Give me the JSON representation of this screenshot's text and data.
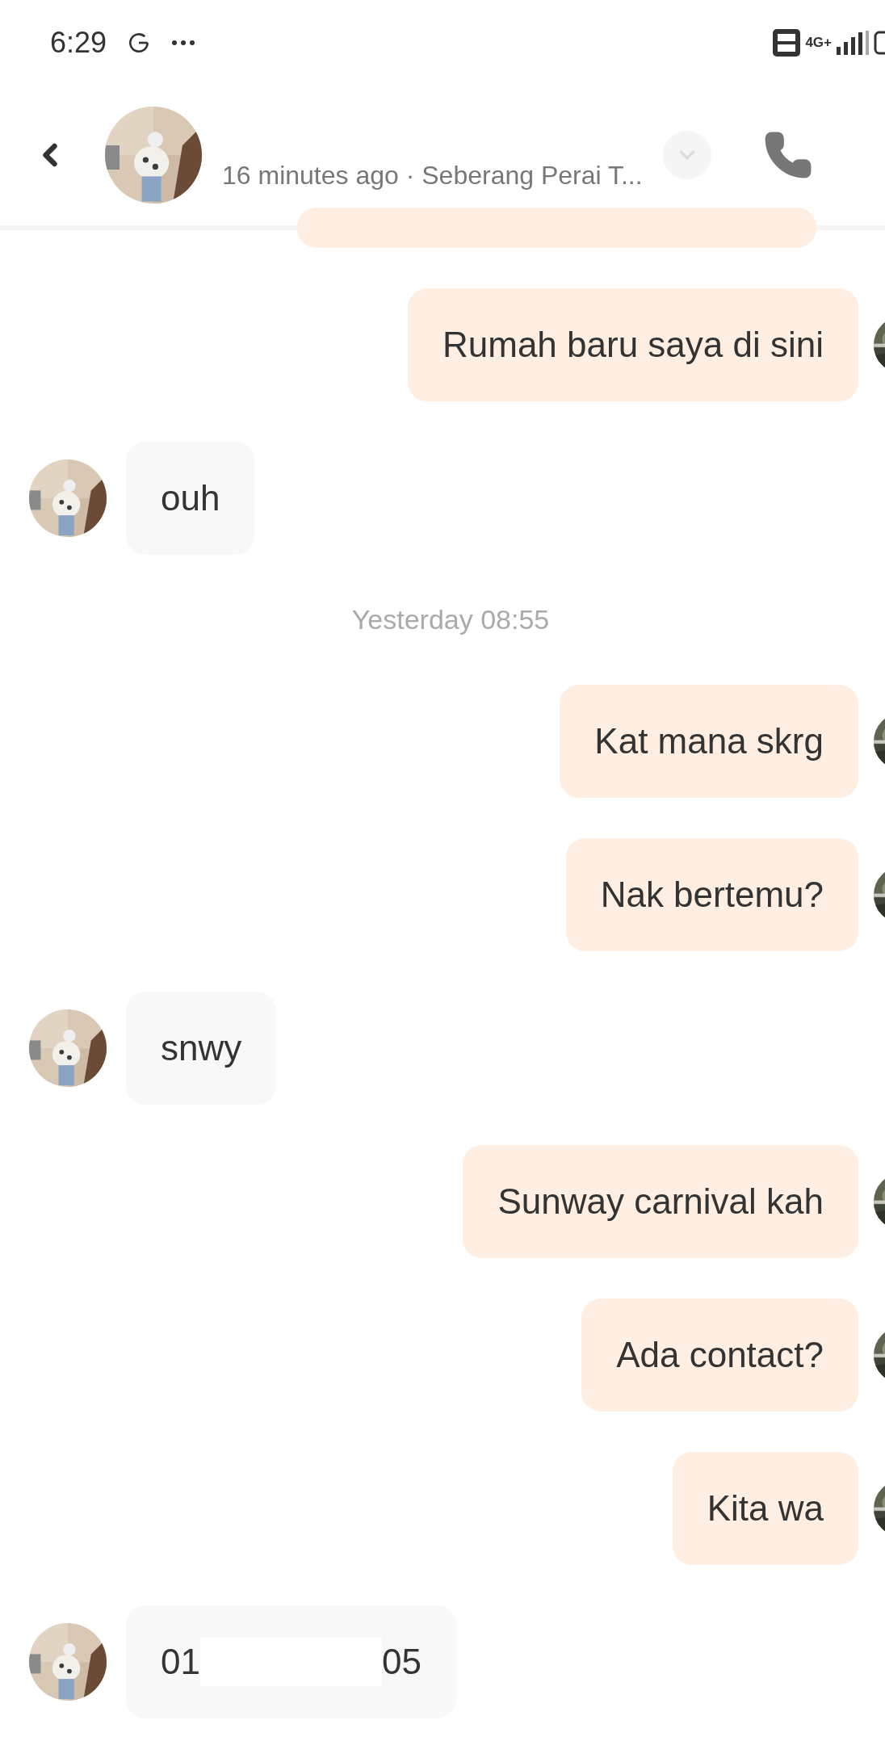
{
  "status_bar": {
    "time": "6:29",
    "network": "4G+"
  },
  "header": {
    "subtitle": "16 minutes ago · Seberang Perai T..."
  },
  "messages": [
    {
      "kind": "partial"
    },
    {
      "kind": "sent",
      "text": "Rumah baru saya di sini"
    },
    {
      "kind": "received",
      "text": "ouh"
    },
    {
      "kind": "timestamp",
      "text": "Yesterday 08:55"
    },
    {
      "kind": "sent",
      "text": "Kat mana skrg"
    },
    {
      "kind": "sent",
      "text": "Nak bertemu?"
    },
    {
      "kind": "received",
      "text": "snwy"
    },
    {
      "kind": "sent",
      "text": "Sunway carnival kah"
    },
    {
      "kind": "sent",
      "text": "Ada contact?"
    },
    {
      "kind": "sent",
      "text": "Kita wa"
    },
    {
      "kind": "received_redacted",
      "parts": [
        "01",
        "05"
      ]
    }
  ]
}
